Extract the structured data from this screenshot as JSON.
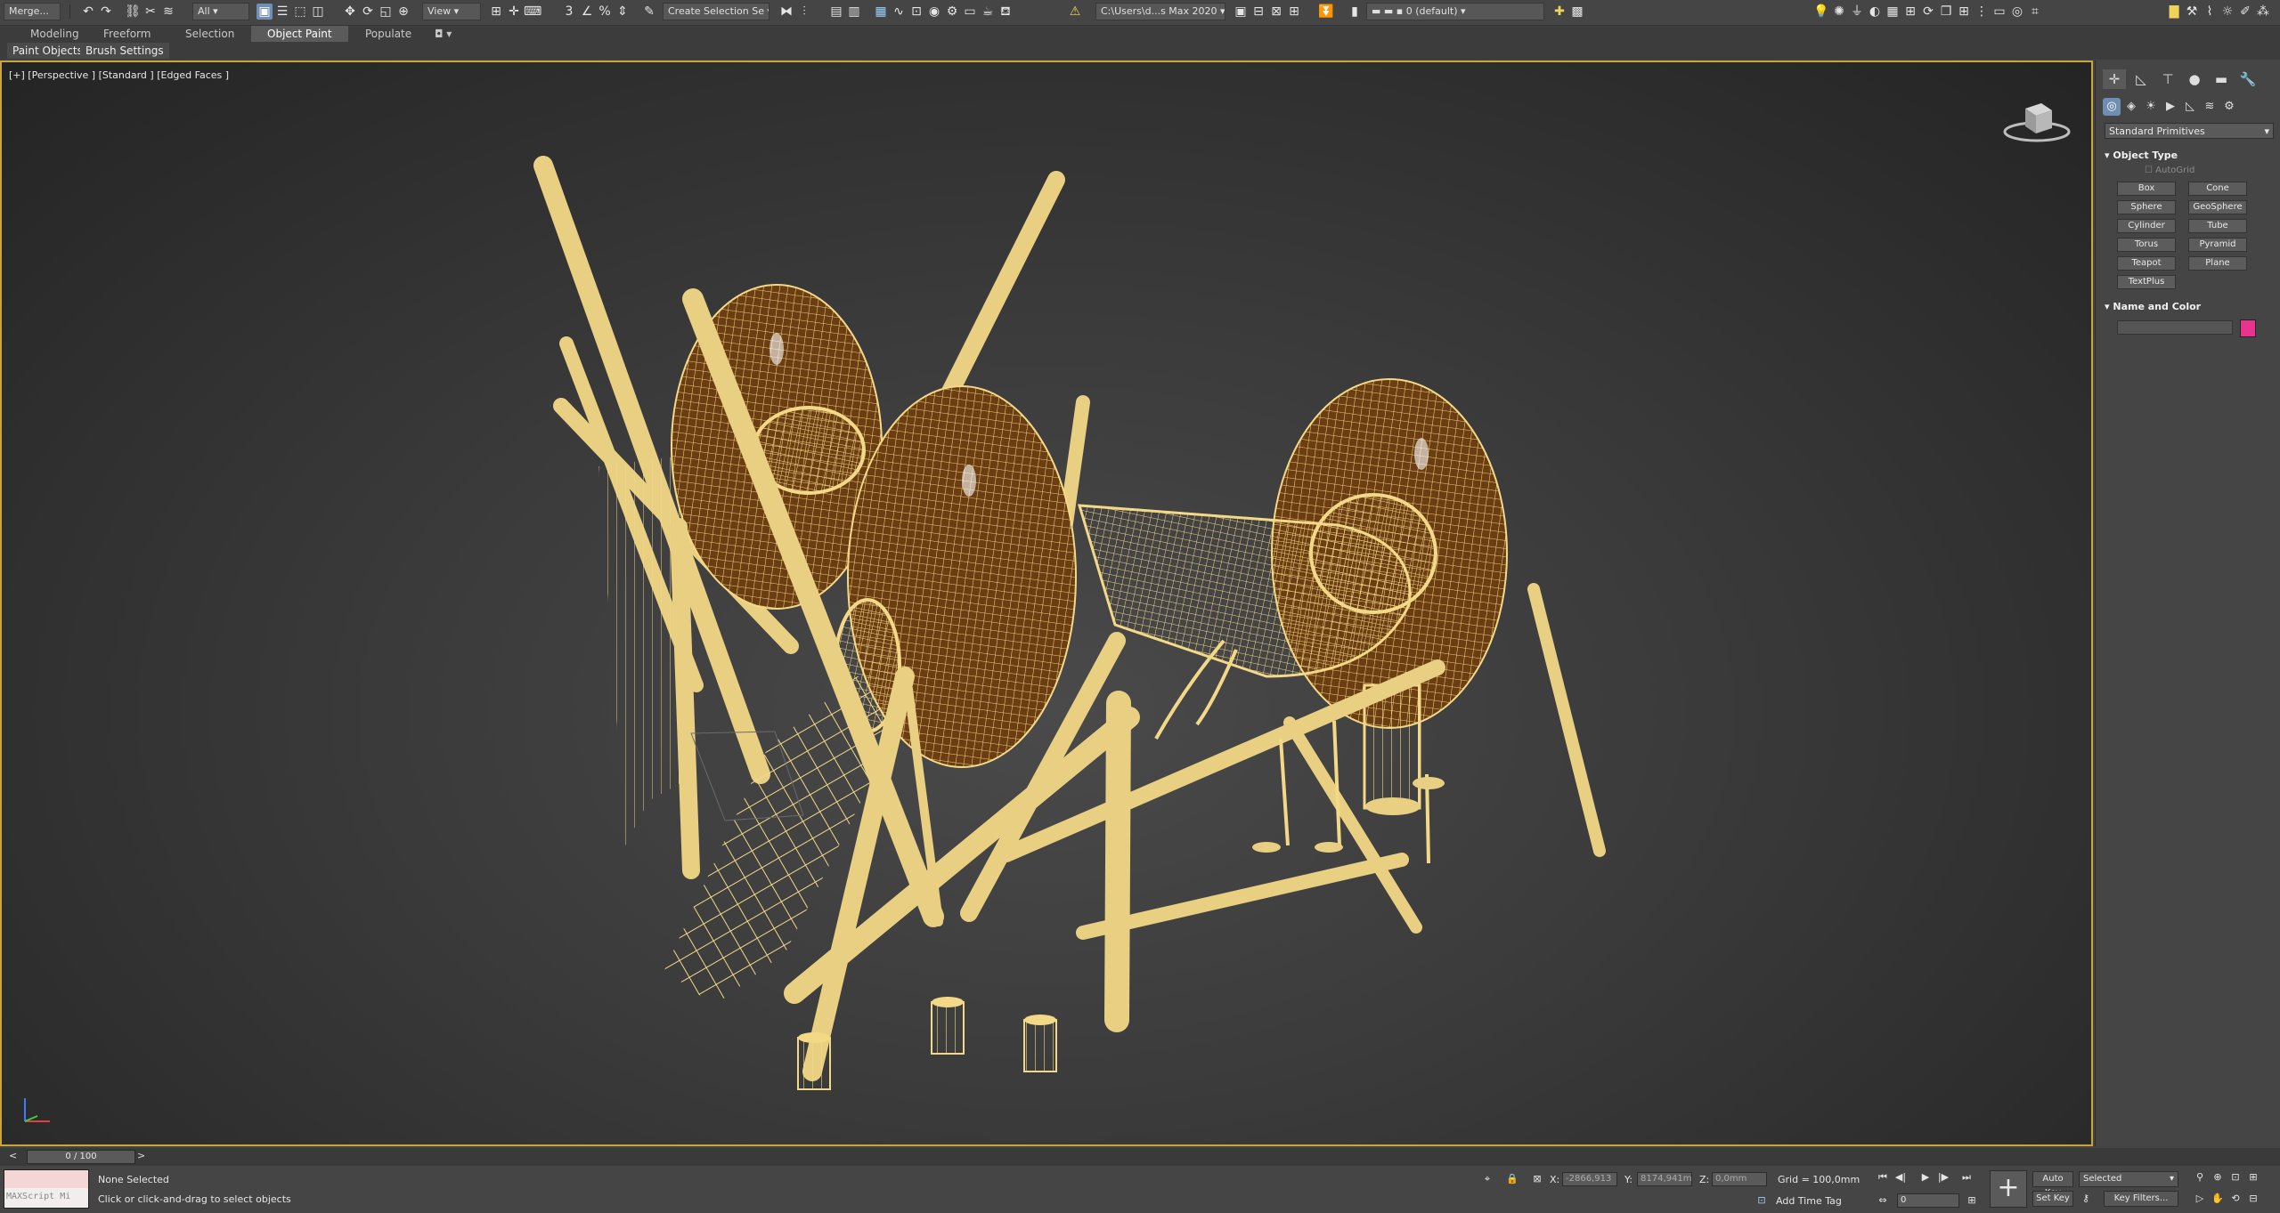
{
  "toolbar": {
    "merge_label": "Merge...",
    "selection_filter": "All",
    "ref_coord": "View",
    "named_selection": "Create Selection Se",
    "project_path": "C:\\Users\\d...s Max 2020",
    "layer": "0 (default)"
  },
  "ribbon": {
    "tabs": [
      "Modeling",
      "Freeform",
      "Selection",
      "Object Paint",
      "Populate"
    ],
    "active_tab": "Object Paint",
    "subpanels": [
      "Paint Objects",
      "Brush Settings"
    ]
  },
  "viewport": {
    "label": "[+] [Perspective ] [Standard ] [Edged Faces ]",
    "wire_color": "#f3d987",
    "fill_color": "#6b3d12"
  },
  "command_panel": {
    "dropdown": "Standard Primitives",
    "object_type_title": "Object Type",
    "autogrid_label": "AutoGrid",
    "primitives": [
      "Box",
      "Cone",
      "Sphere",
      "GeoSphere",
      "Cylinder",
      "Tube",
      "Torus",
      "Pyramid",
      "Teapot",
      "Plane",
      "TextPlus"
    ],
    "name_color_title": "Name and Color",
    "swatch_color": "#e8348c"
  },
  "timeline": {
    "frame": "0 / 100"
  },
  "status": {
    "maxscript_placeholder": "MAXScript Mi",
    "selection": "None Selected",
    "prompt": "Click or click-and-drag to select objects",
    "x_label": "X:",
    "x_value": "-2866,913",
    "y_label": "Y:",
    "y_value": "8174,941m",
    "z_label": "Z:",
    "z_value": "0,0mm",
    "grid": "Grid = 100,0mm",
    "add_time_tag": "Add Time Tag",
    "auto_key": "Auto Key",
    "selected_dropdown": "Selected",
    "set_key": "Set Key",
    "key_filters": "Key Filters...",
    "frame_field": "0"
  }
}
